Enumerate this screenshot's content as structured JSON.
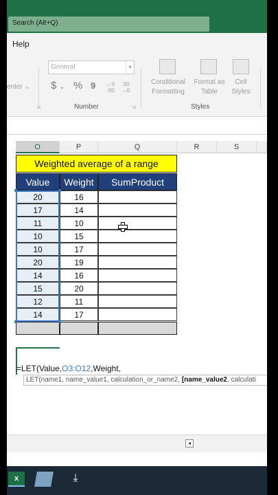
{
  "titlebar": {
    "search_placeholder": "Search (Alt+Q)"
  },
  "ribbon": {
    "menu_help": "Help",
    "center_fragment": "enter",
    "number_format_value": "General",
    "currency_symbol": "$",
    "percent_symbol": "%",
    "comma_symbol": "9",
    "inc_decimal": "←0 .00",
    "dec_decimal": ".00 →0",
    "number_group": "Number",
    "conditional_formatting": "Conditional Formatting",
    "format_as_table": "Format as Table",
    "cell_styles": "Cell Styles",
    "styles_group": "Styles"
  },
  "columns": [
    "O",
    "P",
    "Q",
    "R",
    "S"
  ],
  "table": {
    "title": "Weighted average of a range",
    "headers": [
      "Value",
      "Weight",
      "SumProduct"
    ],
    "rows": [
      {
        "value": "20",
        "weight": "16"
      },
      {
        "value": "17",
        "weight": "14"
      },
      {
        "value": "11",
        "weight": "10"
      },
      {
        "value": "10",
        "weight": "15"
      },
      {
        "value": "10",
        "weight": "17"
      },
      {
        "value": "20",
        "weight": "19"
      },
      {
        "value": "14",
        "weight": "16"
      },
      {
        "value": "15",
        "weight": "20"
      },
      {
        "value": "12",
        "weight": "11"
      },
      {
        "value": "14",
        "weight": "17"
      }
    ]
  },
  "formula": {
    "prefix": "=LET(Value,",
    "range_ref": "O3:O12",
    "suffix": ",Weight,"
  },
  "tooltip": {
    "before": "LET(name1, name_value1, calculation_or_name2, ",
    "bold": "[name_value2",
    "after": ", calculati"
  },
  "taskbar": {
    "excel_label": "x"
  },
  "colors": {
    "excel_green": "#1e7145",
    "header_blue": "#213f7a",
    "title_yellow": "#ffff00",
    "selection_blue": "#3d78c8"
  }
}
